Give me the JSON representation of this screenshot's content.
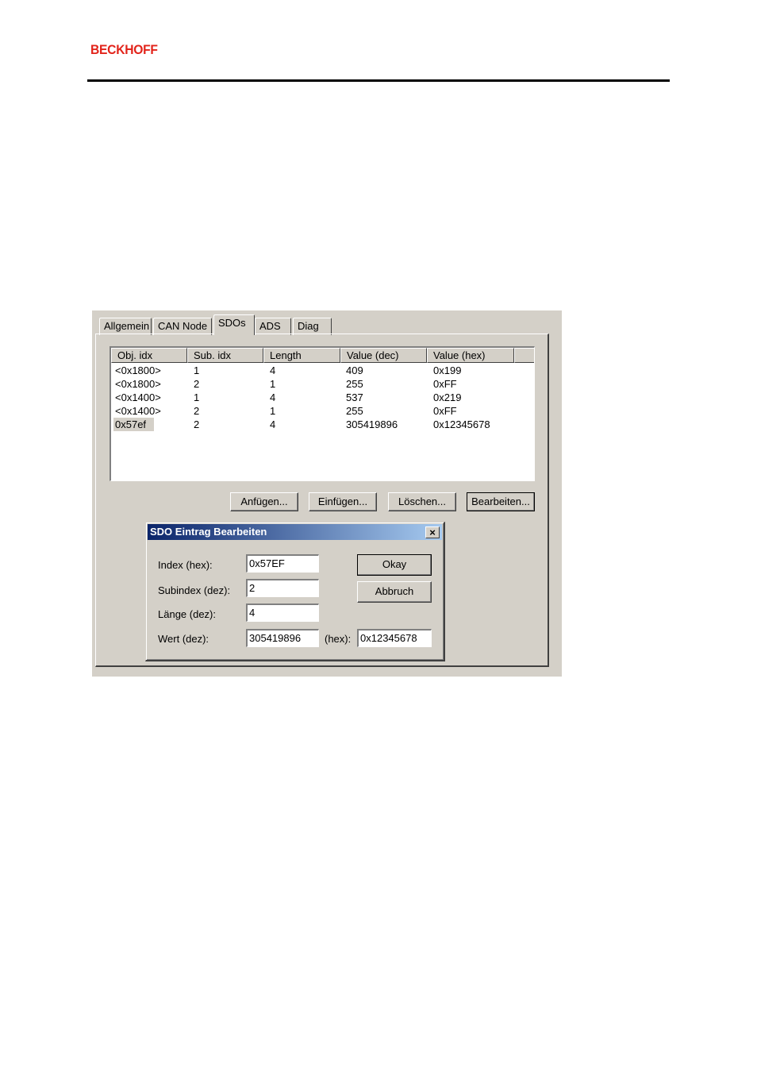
{
  "header": {
    "brand": "BECKHOFF"
  },
  "tabs": [
    {
      "label": "Allgemein"
    },
    {
      "label": "CAN Node"
    },
    {
      "label": "SDOs"
    },
    {
      "label": "ADS"
    },
    {
      "label": "Diag"
    }
  ],
  "sdo_list": {
    "columns": [
      "Obj. idx",
      "Sub. idx",
      "Length",
      "Value (dec)",
      "Value (hex)"
    ],
    "rows": [
      [
        "<0x1800>",
        "1",
        "4",
        "409",
        "0x199"
      ],
      [
        "<0x1800>",
        "2",
        "1",
        "255",
        "0xFF"
      ],
      [
        "<0x1400>",
        "1",
        "4",
        "537",
        "0x219"
      ],
      [
        "<0x1400>",
        "2",
        "1",
        "255",
        "0xFF"
      ],
      [
        "0x57ef",
        "2",
        "4",
        "305419896",
        "0x12345678"
      ]
    ]
  },
  "actions": {
    "append": "Anfügen...",
    "insert": "Einfügen...",
    "delete": "Löschen...",
    "edit": "Bearbeiten..."
  },
  "dialog": {
    "title": "SDO Eintrag Bearbeiten",
    "close_glyph": "×",
    "index_label": "Index (hex):",
    "index_value": "0x57EF",
    "subindex_label": "Subindex (dez):",
    "subindex_value": "2",
    "length_label": "Länge (dez):",
    "length_value": "4",
    "value_label": "Wert (dez):",
    "value_dec": "305419896",
    "hex_label": "(hex):",
    "value_hex": "0x12345678",
    "ok": "Okay",
    "cancel": "Abbruch"
  }
}
